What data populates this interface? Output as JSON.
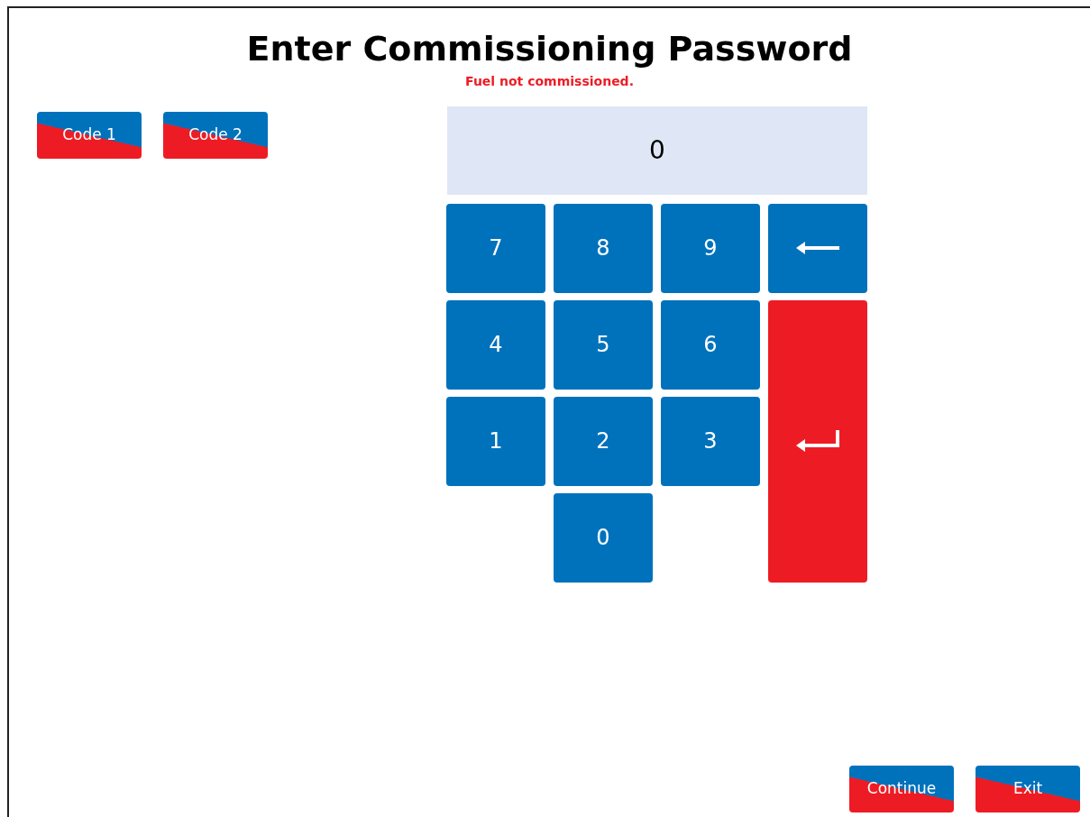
{
  "title": "Enter Commissioning Password",
  "status": "Fuel not commissioned.",
  "code_buttons": [
    "Code 1",
    "Code 2"
  ],
  "display": {
    "value": "0"
  },
  "keys": [
    {
      "kind": "digit",
      "label": "7"
    },
    {
      "kind": "digit",
      "label": "8"
    },
    {
      "kind": "digit",
      "label": "9"
    },
    {
      "kind": "backspace"
    },
    {
      "kind": "digit",
      "label": "4"
    },
    {
      "kind": "digit",
      "label": "5"
    },
    {
      "kind": "digit",
      "label": "6"
    },
    {
      "kind": "enter"
    },
    {
      "kind": "digit",
      "label": "1"
    },
    {
      "kind": "digit",
      "label": "2"
    },
    {
      "kind": "digit",
      "label": "3"
    },
    {
      "kind": "digit",
      "label": "0"
    }
  ],
  "footer_buttons": [
    "Continue",
    "Exit"
  ]
}
